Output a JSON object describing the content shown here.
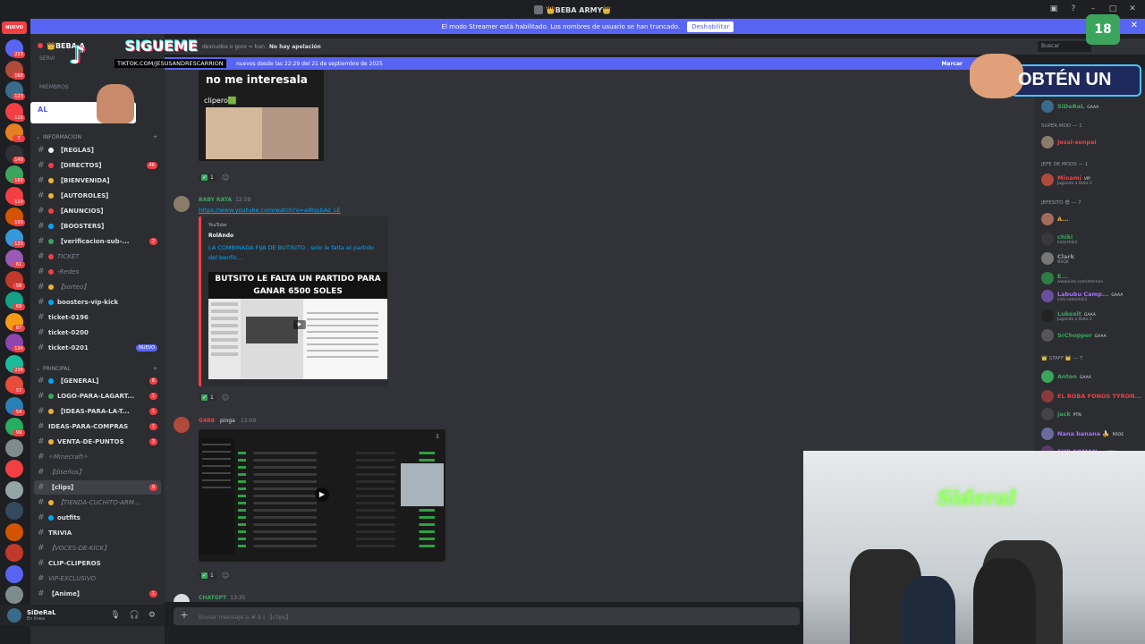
{
  "window": {
    "title": "👑BEBA ARMY👑"
  },
  "streamer_banner": {
    "text": "El modo Streamer está habilitado. Los nombres de usuario se han truncado.",
    "button": "Deshabilitar"
  },
  "rail": {
    "nuevo": "NUEVO",
    "badges": [
      "223",
      "168",
      "123",
      "116",
      "7",
      "140",
      "160",
      "110",
      "193",
      "133",
      "61",
      "58",
      "69",
      "87",
      "124",
      "236",
      "57",
      "54",
      "99"
    ]
  },
  "server": {
    "name": "👑BEBA A"
  },
  "sidebar": {
    "misc": [
      "SERVI",
      "MIEMBROS"
    ],
    "categories": {
      "info": "INFORMACION",
      "principal": "PRINCIPAL"
    },
    "channels": [
      {
        "label": "【REGLAS】",
        "badge": "",
        "dim": false,
        "color": "#f2f3f5"
      },
      {
        "label": "【DIRECTOS】",
        "badge": "46",
        "dim": false,
        "color": "#f23f43"
      },
      {
        "label": "【BIENVENIDA】",
        "badge": "",
        "dim": false,
        "color": "#f0b232"
      },
      {
        "label": "【AUTOROLES】",
        "badge": "",
        "dim": false,
        "color": "#f0b232"
      },
      {
        "label": "【ANUNCIOS】",
        "badge": "",
        "dim": false,
        "color": "#f23f43"
      },
      {
        "label": "【BOOSTERS】",
        "badge": "",
        "dim": false,
        "color": "#00a8fc"
      },
      {
        "label": "【verificacion-sub-...",
        "badge": "2",
        "dim": false,
        "color": "#3ba55d"
      },
      {
        "label": "TICKET",
        "badge": "",
        "dim": true,
        "color": "#f23f43"
      },
      {
        "label": "-Redes",
        "badge": "",
        "dim": true,
        "color": "#f23f43"
      },
      {
        "label": "【sorteo】",
        "badge": "",
        "dim": true,
        "color": "#f0b232"
      },
      {
        "label": "boosters-vip-kick",
        "badge": "",
        "dim": false,
        "color": "#00a8fc"
      },
      {
        "label": "ticket-0196",
        "badge": "",
        "dim": false,
        "color": ""
      },
      {
        "label": "ticket-0200",
        "badge": "",
        "dim": false,
        "color": ""
      },
      {
        "label": "ticket-0201",
        "badge": "NUEVO",
        "dim": false,
        "color": ""
      },
      {
        "label": "【GENERAL】",
        "badge": "6",
        "dim": false,
        "color": "#00a8fc"
      },
      {
        "label": "LOGO-PARA-LAGART...",
        "badge": "1",
        "dim": false,
        "color": "#3ba55d"
      },
      {
        "label": "【IDEAS-PARA-LA-T...",
        "badge": "1",
        "dim": false,
        "color": "#f0b232"
      },
      {
        "label": "IDEAS-PARA-COMPRAS",
        "badge": "1",
        "dim": false,
        "color": ""
      },
      {
        "label": "VENTA-DE-PUNTOS",
        "badge": "3",
        "dim": false,
        "color": "#f0b232"
      },
      {
        "label": "✧Minecraft✧",
        "badge": "",
        "dim": true,
        "color": ""
      },
      {
        "label": "【diseños】",
        "badge": "",
        "dim": true,
        "color": ""
      },
      {
        "label": "【clips】",
        "badge": "9",
        "dim": false,
        "color": ""
      },
      {
        "label": "【TIENDA-CUCHITO-ARM...",
        "badge": "",
        "dim": true,
        "color": "#f0b232"
      },
      {
        "label": "outfits",
        "badge": "",
        "dim": false,
        "color": "#00a8fc"
      },
      {
        "label": "TRIVIA",
        "badge": "",
        "dim": false,
        "color": ""
      },
      {
        "label": "【VOCES-DE-KICK】",
        "badge": "",
        "dim": true,
        "color": ""
      },
      {
        "label": "CLIP-CLIPEROS",
        "badge": "",
        "dim": false,
        "color": ""
      },
      {
        "label": "VIP-EXCLUSIVO",
        "badge": "",
        "dim": true,
        "color": ""
      },
      {
        "label": "【Anime】",
        "badge": "1",
        "dim": false,
        "color": ""
      }
    ]
  },
  "user": {
    "name": "SiDeRaL",
    "status": "En línea"
  },
  "header": {
    "rules": "desnudos o gore = ban.",
    "rules_bold": "No hay apelación",
    "search": "Buscar"
  },
  "newbar": {
    "text": "nuevos desde las 22:29 del 21 de septiembre de 2025",
    "mark": "Marcar"
  },
  "messages": {
    "img_caption": "no me interesala",
    "img_sub": "clipero🟩",
    "m1_author": "BABY RATA",
    "m1_time": "12:59",
    "m1_link": "https://www.youtube.com/watch?v=a8bjybAz_LE",
    "m1_provider": "YouTube",
    "m1_channel": "RolAndo",
    "m1_title": "LA COMBINADA FIJA DE BUTISITO , solo le falta el partido del benfic...",
    "m1_thumb": "BUTSITO LE FALTA UN PARTIDO PARA GANAR 6500 SOLES",
    "m2_author": "G4R8",
    "m2_tag": "pinga",
    "m2_time": "13:09",
    "m3_author": "CHATGPT",
    "m3_time": "13:35",
    "reaction_count": "1"
  },
  "composer": {
    "placeholder": "Enviar mensaje a # $ | 【clips】"
  },
  "members": {
    "cat_super": "SUPER MOD — 1",
    "cat_jefe": "JEFE DE MODS — 1",
    "cat_jefesito": "JEFESITO 😎 — 7",
    "cat_staff": "👑 STAFF 👑 — 7",
    "list": [
      {
        "name": "SiDeRaL",
        "sub": "",
        "tag": "GAAA",
        "color": "#3ba55d"
      },
      {
        "name": "Jessi-senpai",
        "sub": "",
        "tag": "",
        "color": "#f23f43"
      },
      {
        "name": "Minami",
        "sub": "Jugando a Dota 2",
        "tag": "VIP",
        "color": "#f23f43"
      },
      {
        "name": "A...",
        "sub": "",
        "tag": "",
        "color": "#f0b232"
      },
      {
        "name": "chiki",
        "sub": "kick/chik1",
        "tag": "",
        "color": "#3ba55d"
      },
      {
        "name": "Clark",
        "sub": "NSQK",
        "tag": "",
        "color": "#949ba4"
      },
      {
        "name": "E...",
        "sub": "www.kick.com/eternoo",
        "tag": "",
        "color": "#3ba55d"
      },
      {
        "name": "Labubu Camp...",
        "sub": "kick.com/chik1",
        "tag": "GAAA",
        "color": "#a970ff"
      },
      {
        "name": "Lukexit",
        "sub": "Jugando a Dota 2",
        "tag": "GAAA",
        "color": "#3ba55d"
      },
      {
        "name": "SrChopper",
        "sub": "",
        "tag": "GAAA",
        "color": "#3ba55d"
      },
      {
        "name": "Anton",
        "sub": "",
        "tag": "GAAA",
        "color": "#3ba55d"
      },
      {
        "name": "EL ROBA FONOS TYRON...",
        "sub": "",
        "tag": "",
        "color": "#f23f43"
      },
      {
        "name": "jack",
        "sub": "",
        "tag": "PTN",
        "color": "#3ba55d"
      },
      {
        "name": "Nana banana 🍌",
        "sub": "",
        "tag": "RROE",
        "color": "#a970ff"
      },
      {
        "name": "SUB COMAN...",
        "sub": "",
        "tag": "KICK",
        "color": "#a970ff"
      }
    ]
  },
  "overlay": {
    "tiktok_logo": "♪",
    "sigueme": "SIGUEME",
    "handle": "TIKTOK.COM/JESUSANDRESCARRION",
    "al": "AL",
    "obten": "OBTÉN UN",
    "age": "18",
    "neon": "Sideral"
  }
}
